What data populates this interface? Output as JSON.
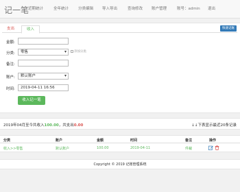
{
  "header": {
    "brand": "记一笔",
    "nav": [
      "近期统计",
      "全年统计",
      "分类编辑",
      "导入导出",
      "查询修改",
      "账户管理",
      "账号：admin",
      "退出"
    ]
  },
  "form": {
    "tabs": [
      "支出",
      "收入"
    ],
    "quick_button": "快速记账",
    "amount_label": "金额:",
    "amount_value": "",
    "category_label": "分类:",
    "category_value": "零售",
    "category_hint": "添加分类",
    "note_label": "备注:",
    "note_value": "",
    "account_label": "账户:",
    "account_value": "默认账户",
    "time_label": "时间:",
    "time_value": "2019-04-11 16:56",
    "submit_label": "收入记一笔"
  },
  "summary": {
    "prefix": "2019年04月至今共收入",
    "income": "100.00",
    "middle": "，共支出",
    "expense": "0.00",
    "right": "↓↓下表显示最近20条记录"
  },
  "table": {
    "headers": [
      "分类",
      "账户",
      "金额",
      "时间",
      "备注",
      "操作"
    ],
    "rows": [
      {
        "category": "收入>>零售",
        "account": "默认账户",
        "amount": "100.00",
        "time": "2019-04-11",
        "note": "件裁"
      }
    ]
  },
  "footer": {
    "text": "Copyright © 2019 记账管理系统"
  },
  "colors": {
    "income": "#5cb85c",
    "expense": "#d9534f",
    "primary": "#337ab7"
  }
}
